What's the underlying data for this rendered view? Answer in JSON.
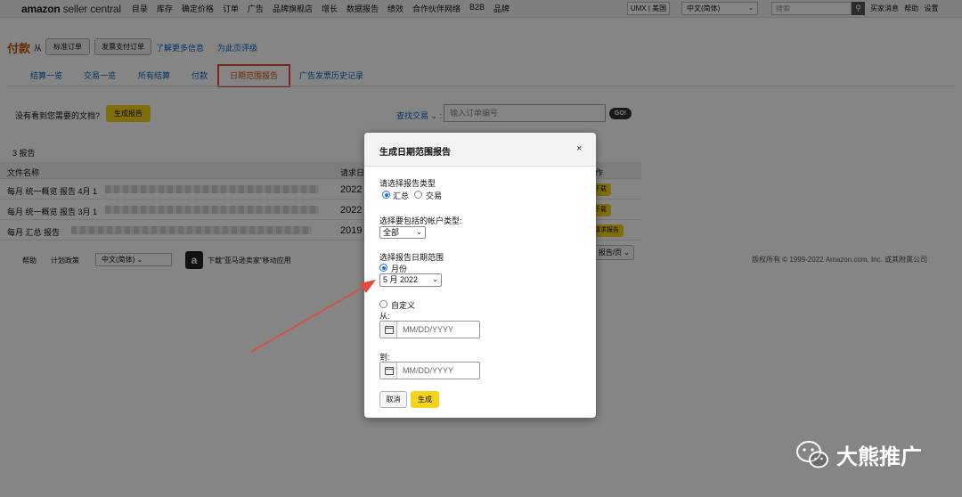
{
  "topnav": {
    "logo_a": "amazon",
    "logo_b": " seller central",
    "items": [
      "目录",
      "库存",
      "确定价格",
      "订单",
      "广告",
      "品牌旗舰店",
      "增长",
      "数据报告",
      "绩效",
      "合作伙伴网络",
      "B2B",
      "品牌"
    ],
    "marketplace": "UMX | 美国",
    "language": "中文(简体)",
    "search_placeholder": "搜索",
    "links": [
      "买家消息",
      "帮助",
      "设置"
    ]
  },
  "header": {
    "title": "付款",
    "from": "从",
    "btn_standard": "标准订单",
    "btn_invoice": "发票支付订单",
    "learn_more": "了解更多信息",
    "rate_page": "为此页评级"
  },
  "tabs": {
    "items": [
      "结算一览",
      "交易一览",
      "所有结算",
      "付款"
    ],
    "active": "日期范围报告",
    "ad_invoice": "广告发票历史记录"
  },
  "toolbar": {
    "not_seen": "没有看到您需要的文档?",
    "generate": "生成报告",
    "find": "查找交易",
    "order_placeholder": "输入订单编号",
    "go": "GO!"
  },
  "table": {
    "count": "3 报告",
    "col_name": "文件名称",
    "col_date": "请求日",
    "col_action": "作",
    "rows": [
      {
        "name": "每月 统一概览 报告 4月 1",
        "date": "2022",
        "action": "下载"
      },
      {
        "name": "每月 统一概览 报告 3月 1",
        "date": "2022",
        "action": "下载"
      },
      {
        "name": "每月 汇总 报告",
        "date": "2019",
        "action": "请求报告"
      }
    ],
    "per_page": "报告/页"
  },
  "footer": {
    "help": "帮助",
    "policy": "计划政策",
    "language": "中文(简体)",
    "app_icon_letter": "a",
    "app": "下载\"亚马逊卖家\"移动应用",
    "copyright": "版权所有 © 1999-2022 Amazon.com, Inc. 或其附属公司"
  },
  "modal": {
    "title": "生成日期范围报告",
    "close": "×",
    "type_label": "请选择报告类型",
    "type_summary": "汇总",
    "type_transaction": "交易",
    "account_label": "选择要包括的帐户类型:",
    "account_value": "全部",
    "range_label": "选择报告日期范围",
    "monthly": "月份",
    "month_value": "5 月 2022",
    "custom": "自定义",
    "from": "从:",
    "to": "到:",
    "date_placeholder": "MM/DD/YYYY",
    "cancel": "取消",
    "submit": "生成"
  },
  "watermark": {
    "text": "大熊推广"
  },
  "colors": {
    "accent_yellow": "#f5d21b",
    "link_blue": "#0066c0",
    "title_orange": "#c45500",
    "highlight_red": "#e04b3b"
  }
}
